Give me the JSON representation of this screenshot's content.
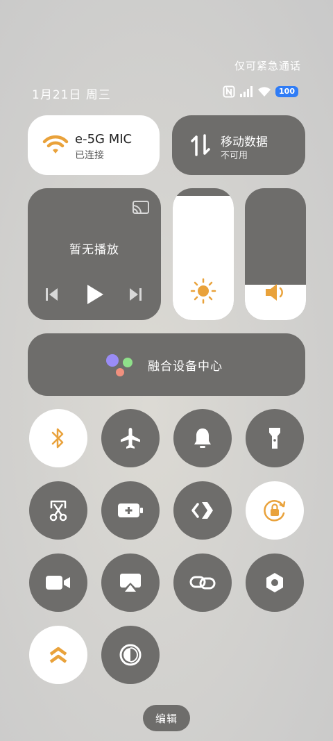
{
  "status_bar": {
    "emergency_text": "仅可紧急通话",
    "date_text": "1月21日 周三",
    "battery_level": "100",
    "icons": [
      "nfc-icon",
      "signal-icon",
      "wifi-icon",
      "battery-icon"
    ]
  },
  "wifi": {
    "ssid": "e-5G        MIC",
    "status": "已连接",
    "active": true,
    "accent": "#e9a23b"
  },
  "mobile_data": {
    "title": "移动数据",
    "status": "不可用",
    "active": false
  },
  "media": {
    "text": "暂无播放"
  },
  "sliders": {
    "brightness_level": 0.94,
    "volume_level": 0.27
  },
  "hub": {
    "label": "融合设备中心"
  },
  "toggles": [
    {
      "name": "bluetooth",
      "icon": "bluetooth-icon",
      "active": true
    },
    {
      "name": "airplane",
      "icon": "airplane-icon",
      "active": false
    },
    {
      "name": "sound",
      "icon": "bell-icon",
      "active": false
    },
    {
      "name": "flashlight",
      "icon": "flashlight-icon",
      "active": false
    },
    {
      "name": "screenshot",
      "icon": "scissors-icon",
      "active": false
    },
    {
      "name": "battery-saver",
      "icon": "battery-plus-icon",
      "active": false
    },
    {
      "name": "share",
      "icon": "share-icon",
      "active": false
    },
    {
      "name": "rotation-lock",
      "icon": "rotation-lock-icon",
      "active": true
    },
    {
      "name": "screen-record",
      "icon": "video-camera-icon",
      "active": false
    },
    {
      "name": "cast",
      "icon": "screen-cast-icon",
      "active": false
    },
    {
      "name": "link",
      "icon": "link-icon",
      "active": false
    },
    {
      "name": "settings",
      "icon": "hexagon-settings-icon",
      "active": false
    },
    {
      "name": "performance",
      "icon": "double-chevron-up-icon",
      "active": true
    },
    {
      "name": "dark-mode",
      "icon": "contrast-icon",
      "active": false
    }
  ],
  "colors": {
    "accent": "#e9a23b",
    "tile_dark": "#6e6d6b",
    "tile_light": "#ffffff"
  },
  "edit_label": "编辑"
}
